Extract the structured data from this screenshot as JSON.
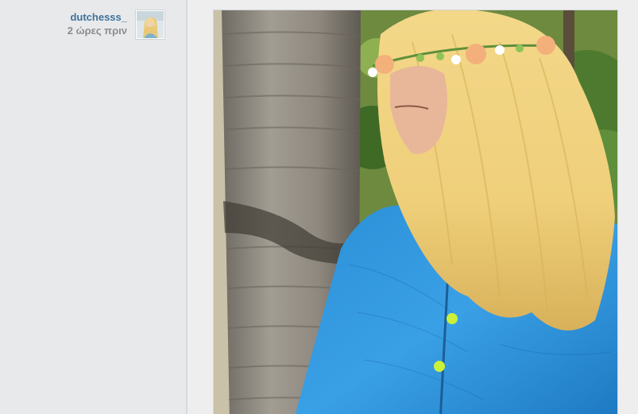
{
  "post": {
    "username": "dutchesss_",
    "timestamp": "2 ώρες πριν"
  },
  "icons": {
    "avatar": "user-avatar-photo"
  },
  "colors": {
    "username": "#3f729b",
    "timestamp": "#8a8d91",
    "background": "#e8e9eb"
  }
}
